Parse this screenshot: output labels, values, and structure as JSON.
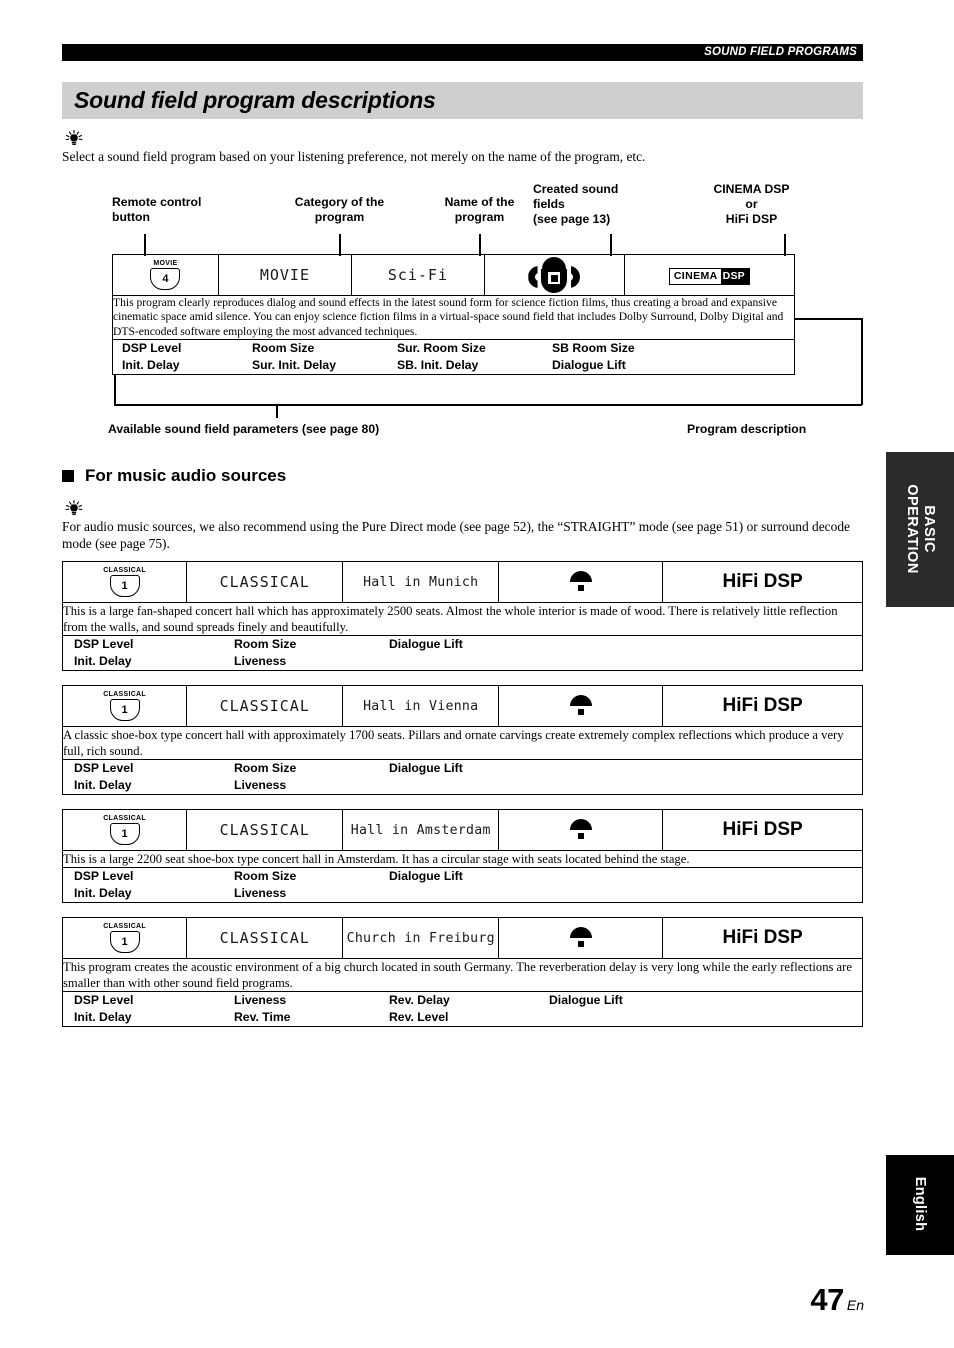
{
  "header": {
    "running_head": "SOUND FIELD PROGRAMS"
  },
  "page_title": "Sound field program descriptions",
  "intro": {
    "tip_icon": "tip-lightbulb-icon",
    "text": "Select a sound field program based on your listening preference, not merely on the name of the program, etc."
  },
  "callouts": {
    "remote_control_button": "Remote control\nbutton",
    "category_of_program": "Category of the\nprogram",
    "name_of_program": "Name of the\nprogram",
    "created_sound_fields": "Created sound\nfields\n(see page 13)",
    "cinema_or_hifi": "CINEMA DSP\nor\nHiFi DSP",
    "available_parameters": "Available sound field parameters (see page 80)",
    "program_description": "Program description"
  },
  "example": {
    "button_label": "MOVIE",
    "button_number": "4",
    "category": "MOVIE",
    "name": "Sci-Fi",
    "sound_field_icon": "cinema-dsp-sound-field-icon",
    "logo_part_a": "CINEMA",
    "logo_part_b": "DSP",
    "description": "This program clearly reproduces dialog and sound effects in the latest sound form for science fiction films, thus creating a broad and expansive cinematic space amid silence. You can enjoy science fiction films in a virtual-space sound field that includes Dolby Surround, Dolby Digital and DTS-encoded software employing the most advanced techniques.",
    "parameters": [
      "DSP Level\nInit. Delay",
      "Room Size\nSur. Init. Delay",
      "Sur. Room Size\nSB. Init. Delay",
      "SB Room Size\nDialogue Lift"
    ]
  },
  "section": {
    "bullet": "square-bullet-icon",
    "heading": "For music audio sources",
    "tip_icon": "tip-lightbulb-icon",
    "text": "For audio music sources, we also recommend using the Pure Direct mode (see page 52), the “STRAIGHT” mode (see page 51) or surround decode mode (see page 75)."
  },
  "programs": [
    {
      "button_label": "CLASSICAL",
      "button_number": "1",
      "category": "CLASSICAL",
      "name": "Hall in Munich",
      "sound_field_icon": "hifi-dsp-sound-field-icon",
      "dsp_type": "HiFi DSP",
      "description": "This is a large fan-shaped concert hall which has approximately 2500 seats. Almost the whole interior is made of wood. There is relatively little reflection from the walls, and sound spreads finely and beautifully.",
      "parameters": [
        "DSP Level\nInit. Delay",
        "Room Size\nLiveness",
        "Dialogue Lift"
      ],
      "param_cols": 3
    },
    {
      "button_label": "CLASSICAL",
      "button_number": "1",
      "category": "CLASSICAL",
      "name": "Hall in Vienna",
      "sound_field_icon": "hifi-dsp-sound-field-icon",
      "dsp_type": "HiFi DSP",
      "description": "A classic shoe-box type concert hall with approximately 1700 seats. Pillars and ornate carvings create extremely complex reflections which produce a very full, rich sound.",
      "parameters": [
        "DSP Level\nInit. Delay",
        "Room Size\nLiveness",
        "Dialogue Lift"
      ],
      "param_cols": 3
    },
    {
      "button_label": "CLASSICAL",
      "button_number": "1",
      "category": "CLASSICAL",
      "name": "Hall in Amsterdam",
      "sound_field_icon": "hifi-dsp-sound-field-icon",
      "dsp_type": "HiFi DSP",
      "description": "This is a large 2200 seat shoe-box type concert hall in Amsterdam. It has a circular stage with seats located behind the stage.",
      "parameters": [
        "DSP Level\nInit. Delay",
        "Room Size\nLiveness",
        "Dialogue Lift"
      ],
      "param_cols": 3
    },
    {
      "button_label": "CLASSICAL",
      "button_number": "1",
      "category": "CLASSICAL",
      "name": "Church in Freiburg",
      "sound_field_icon": "hifi-dsp-sound-field-icon",
      "dsp_type": "HiFi DSP",
      "description": "This program creates the acoustic environment of a big church located in south Germany. The reverberation delay is very long while the early reflections are smaller than with other sound field programs.",
      "parameters": [
        "DSP Level\nInit. Delay",
        "Liveness\nRev. Time",
        "Rev. Delay\nRev. Level",
        "Dialogue Lift"
      ],
      "param_cols": 4
    }
  ],
  "side_tabs": {
    "basic_operation": "BASIC\nOPERATION",
    "english": "English"
  },
  "footer": {
    "page_number": "47",
    "page_suffix": "En"
  },
  "colors": {
    "title_band": "#cfcfcf",
    "header_bar": "#000000",
    "tab_basic": "#2b2b2b",
    "tab_english": "#000000"
  }
}
